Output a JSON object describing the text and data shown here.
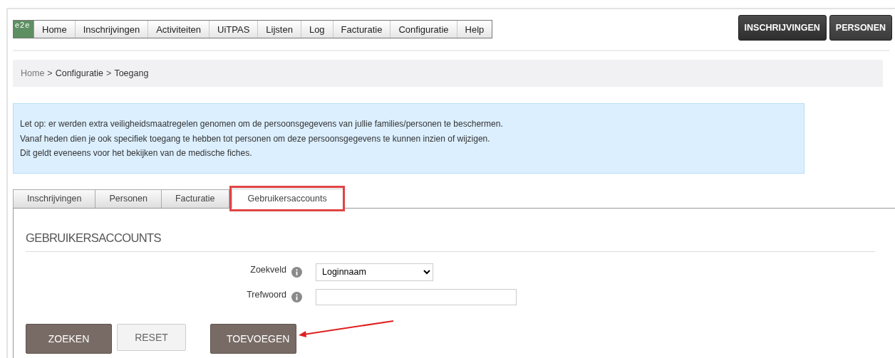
{
  "logo": {
    "text": "e2e"
  },
  "nav": {
    "items": [
      {
        "label": "Home"
      },
      {
        "label": "Inschrijvingen"
      },
      {
        "label": "Activiteiten"
      },
      {
        "label": "UiTPAS"
      },
      {
        "label": "Lijsten"
      },
      {
        "label": "Log"
      },
      {
        "label": "Facturatie"
      },
      {
        "label": "Configuratie"
      },
      {
        "label": "Help"
      }
    ]
  },
  "header_buttons": [
    {
      "label": "INSCHRIJVINGEN"
    },
    {
      "label": "PERSONEN"
    }
  ],
  "breadcrumb": [
    {
      "label": "Home",
      "kind": "link"
    },
    {
      "label": ">",
      "kind": "separator"
    },
    {
      "label": "Configuratie",
      "kind": "text"
    },
    {
      "label": ">",
      "kind": "separator"
    },
    {
      "label": "Toegang",
      "kind": "text"
    }
  ],
  "notice": {
    "lines": [
      "Let op: er werden extra veiligheidsmaatregelen genomen om de persoonsgegevens van jullie families/personen te beschermen.",
      "Vanaf heden dien je ook specifiek toegang te hebben tot personen om deze persoonsgegevens te kunnen inzien of wijzigen.",
      "Dit geldt eveneens voor het bekijken van de medische fiches."
    ]
  },
  "tabs": [
    {
      "label": "Inschrijvingen",
      "selected": false,
      "highlighted": false
    },
    {
      "label": "Personen",
      "selected": false,
      "highlighted": false
    },
    {
      "label": "Facturatie",
      "selected": false,
      "highlighted": false
    },
    {
      "label": "Gebruikersaccounts",
      "selected": true,
      "highlighted": true
    }
  ],
  "panel": {
    "title": "GEBRUIKERSACCOUNTS",
    "fields": [
      {
        "label": "Zoekveld",
        "kind": "select",
        "value": "Loginnaam"
      },
      {
        "label": "Trefwoord",
        "kind": "text"
      }
    ],
    "buttons": [
      {
        "label": "ZOEKEN",
        "kind": "primary",
        "pointed": false
      },
      {
        "label": "RESET",
        "kind": "secondary",
        "pointed": false
      },
      {
        "label": "TOEVOEGEN",
        "kind": "primary",
        "pointed": true
      }
    ]
  }
}
